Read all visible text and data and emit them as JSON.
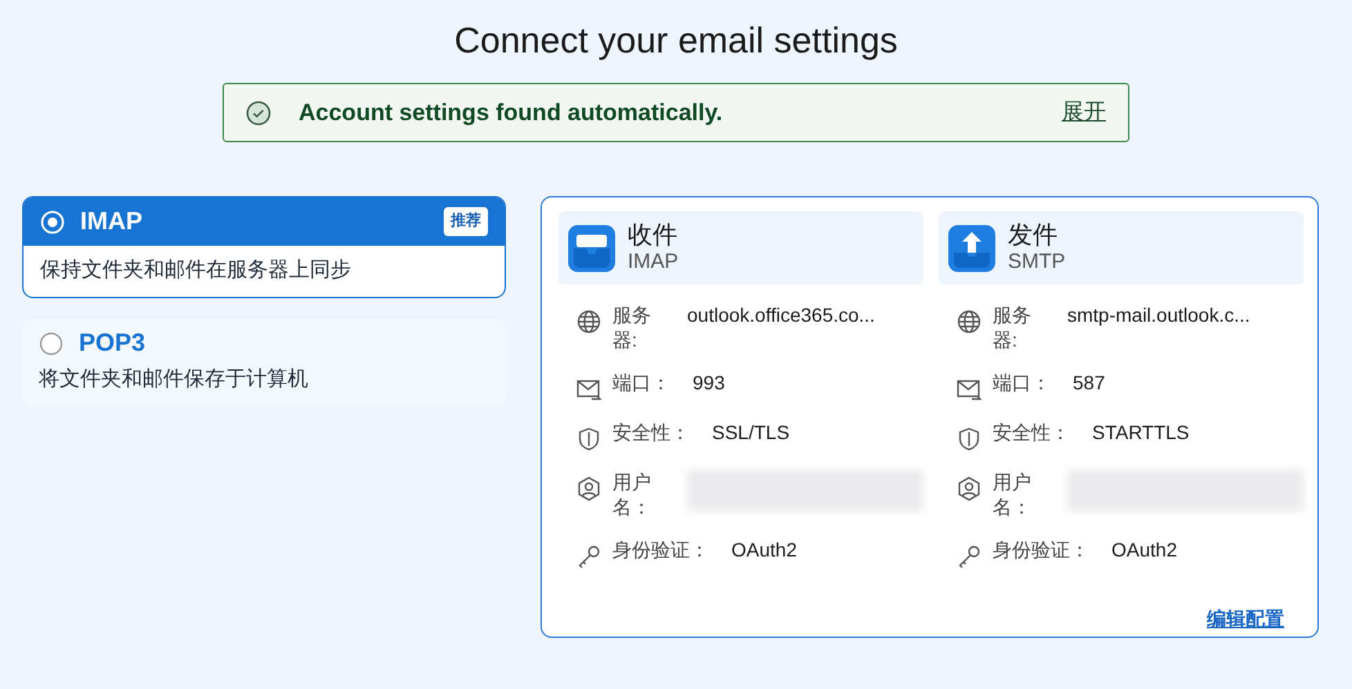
{
  "title": "Connect your email settings",
  "banner": {
    "message": "Account settings found automatically.",
    "link": "展开"
  },
  "protocols": [
    {
      "name": "IMAP",
      "description": "保持文件夹和邮件在服务器上同步",
      "selected": true,
      "badge": "推荐"
    },
    {
      "name": "POP3",
      "description": "将文件夹和邮件保存于计算机",
      "selected": false
    }
  ],
  "servers": [
    {
      "kind": "incoming",
      "title": "收件",
      "protocol": "IMAP",
      "fields": [
        {
          "kind": "server",
          "label": "服务器:",
          "value": "outlook.office365.co..."
        },
        {
          "kind": "port",
          "label": "端口：",
          "value": "993"
        },
        {
          "kind": "security",
          "label": "安全性：",
          "value": "SSL/TLS"
        },
        {
          "kind": "username",
          "label": "用户名：",
          "blurred": true
        },
        {
          "kind": "auth",
          "label": "身份验证：",
          "value": "OAuth2"
        }
      ]
    },
    {
      "kind": "outgoing",
      "title": "发件",
      "protocol": "SMTP",
      "fields": [
        {
          "kind": "server",
          "label": "服务器:",
          "value": "smtp-mail.outlook.c..."
        },
        {
          "kind": "port",
          "label": "端口：",
          "value": "587"
        },
        {
          "kind": "security",
          "label": "安全性：",
          "value": "STARTTLS"
        },
        {
          "kind": "username",
          "label": "用户名：",
          "blurred": true
        },
        {
          "kind": "auth",
          "label": "身份验证：",
          "value": "OAuth2"
        }
      ]
    }
  ],
  "edit_link": "编辑配置"
}
